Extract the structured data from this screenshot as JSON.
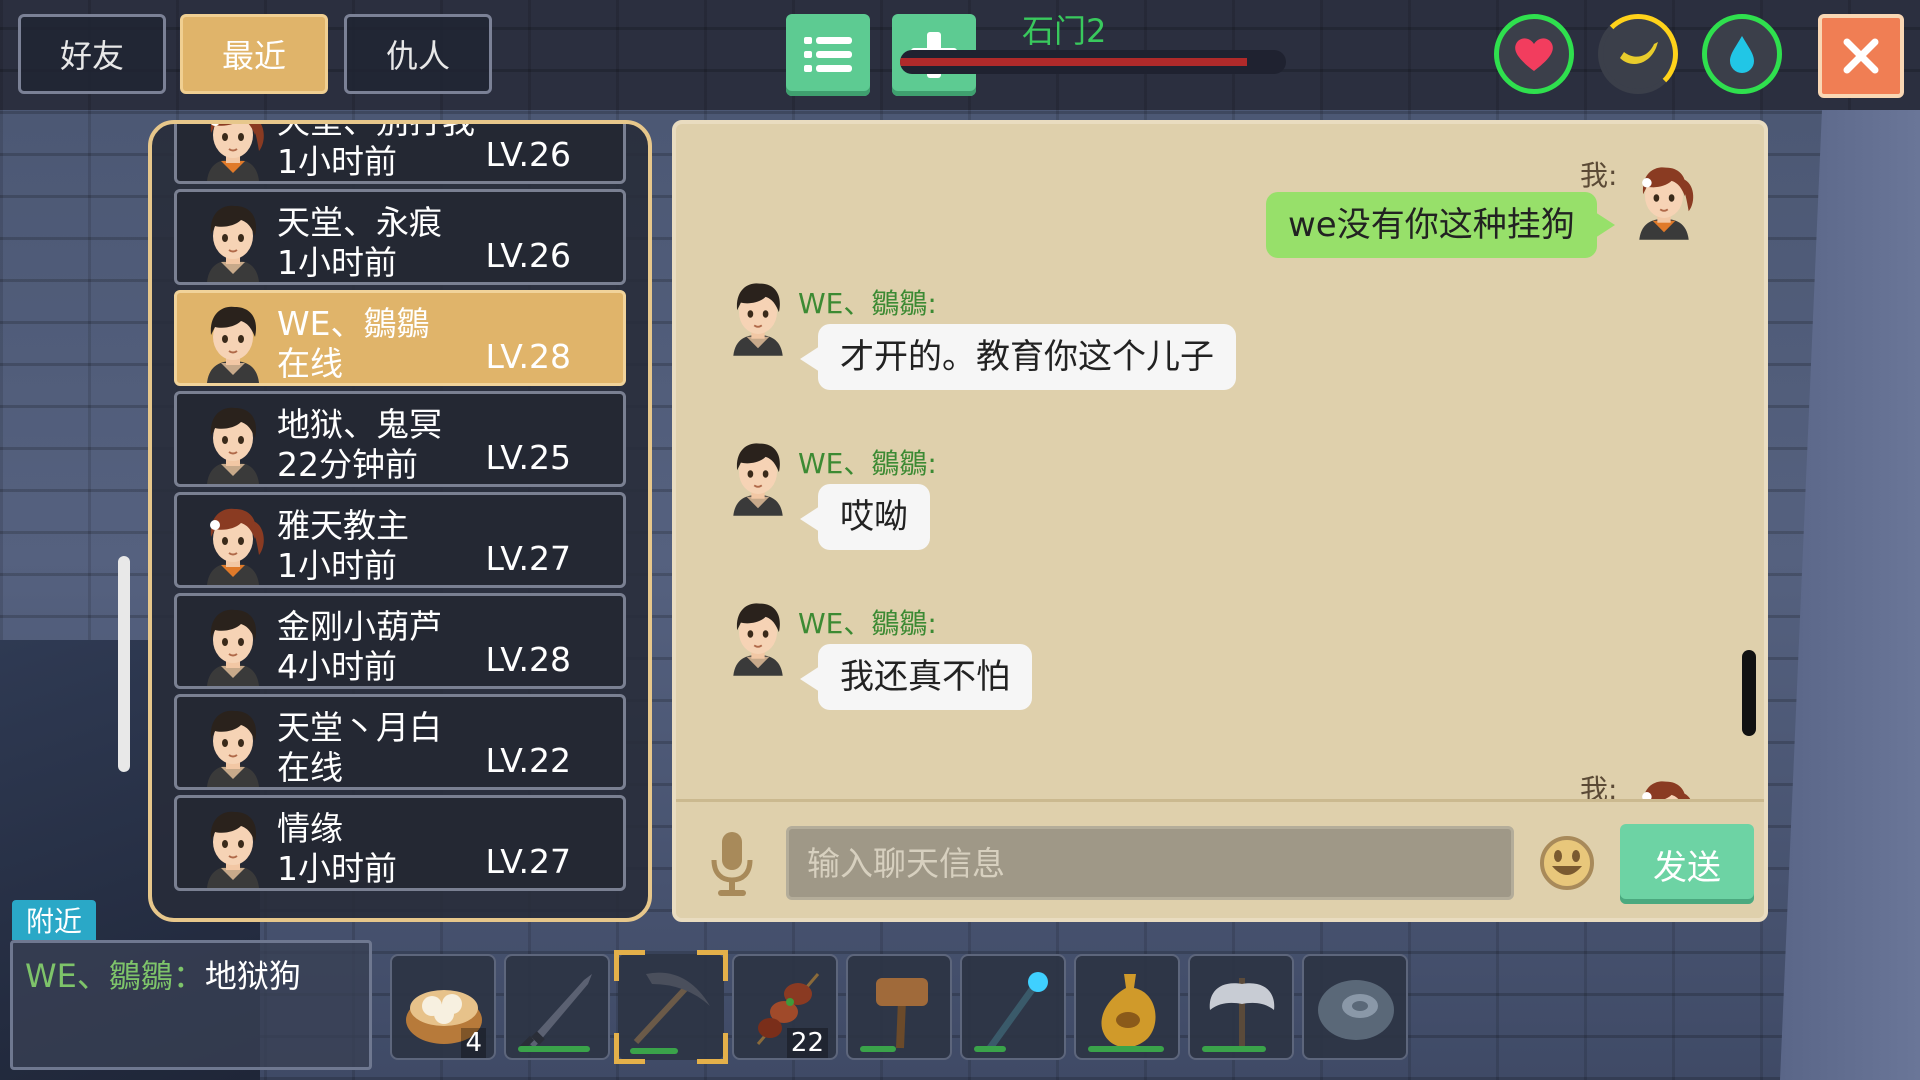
{
  "tabs": [
    {
      "label": "好友",
      "active": false
    },
    {
      "label": "最近",
      "active": true
    },
    {
      "label": "仇人",
      "active": false
    }
  ],
  "toolbar": {
    "list_icon": "list-icon",
    "add_icon": "plus-icon"
  },
  "server": {
    "name": "石门2",
    "health_fraction": 0.9
  },
  "status": {
    "health_icon": "heart-icon",
    "hunger_icon": "banana-icon",
    "hunger_fraction": 0.25,
    "water_icon": "water-drop-icon"
  },
  "friends": [
    {
      "name": "天堂、别打我",
      "time": "1小时前",
      "level": "LV.26",
      "avatar": "girl",
      "selected": false
    },
    {
      "name": "天堂、永痕",
      "time": "1小时前",
      "level": "LV.26",
      "avatar": "boy",
      "selected": false
    },
    {
      "name": "WE、鶵鶵",
      "time": "在线",
      "level": "LV.28",
      "avatar": "boy",
      "selected": true
    },
    {
      "name": "地狱、鬼冥",
      "time": "22分钟前",
      "level": "LV.25",
      "avatar": "boy",
      "selected": false
    },
    {
      "name": "雅天教主",
      "time": "1小时前",
      "level": "LV.27",
      "avatar": "girl",
      "selected": false
    },
    {
      "name": "金刚小葫芦",
      "time": "4小时前",
      "level": "LV.28",
      "avatar": "boy",
      "selected": false
    },
    {
      "name": "天堂丶月白",
      "time": "在线",
      "level": "LV.22",
      "avatar": "boy",
      "selected": false
    },
    {
      "name": "情缘",
      "time": "1小时前",
      "level": "LV.27",
      "avatar": "boy",
      "selected": false
    }
  ],
  "chat": {
    "me_label": "我:",
    "messages": [
      {
        "from": "me",
        "sender": "我:",
        "text": "we没有你这种挂狗"
      },
      {
        "from": "other",
        "sender": "WE、鶵鶵:",
        "text": "才开的。教育你这个儿子"
      },
      {
        "from": "other",
        "sender": "WE、鶵鶵:",
        "text": "哎呦"
      },
      {
        "from": "other",
        "sender": "WE、鶵鶵:",
        "text": "我还真不怕"
      },
      {
        "from": "me",
        "sender": "我:",
        "text": ""
      }
    ],
    "input_placeholder": "输入聊天信息",
    "send_label": "发送",
    "mic_icon": "microphone-icon",
    "emoji_icon": "smiley-icon"
  },
  "nearby": {
    "tag": "附近",
    "sender": "WE、鶵鶵：",
    "text": "地狱狗"
  },
  "hotbar": [
    {
      "item": "steamed-bun-basket-icon",
      "count": "4",
      "durability": null
    },
    {
      "item": "dark-sword-icon",
      "count": "",
      "durability": 0.9
    },
    {
      "item": "pickaxe-icon",
      "count": "",
      "durability": 0.6,
      "selected": true
    },
    {
      "item": "meat-skewer-icon",
      "count": "22",
      "durability": null
    },
    {
      "item": "stone-hammer-icon",
      "count": "",
      "durability": 0.45
    },
    {
      "item": "magic-staff-icon",
      "count": "",
      "durability": 0.4
    },
    {
      "item": "water-gourd-icon",
      "count": "",
      "durability": 0.95
    },
    {
      "item": "battle-axe-icon",
      "count": "",
      "durability": 0.8
    },
    {
      "item": "stone-disc-icon",
      "count": "",
      "durability": null
    }
  ]
}
